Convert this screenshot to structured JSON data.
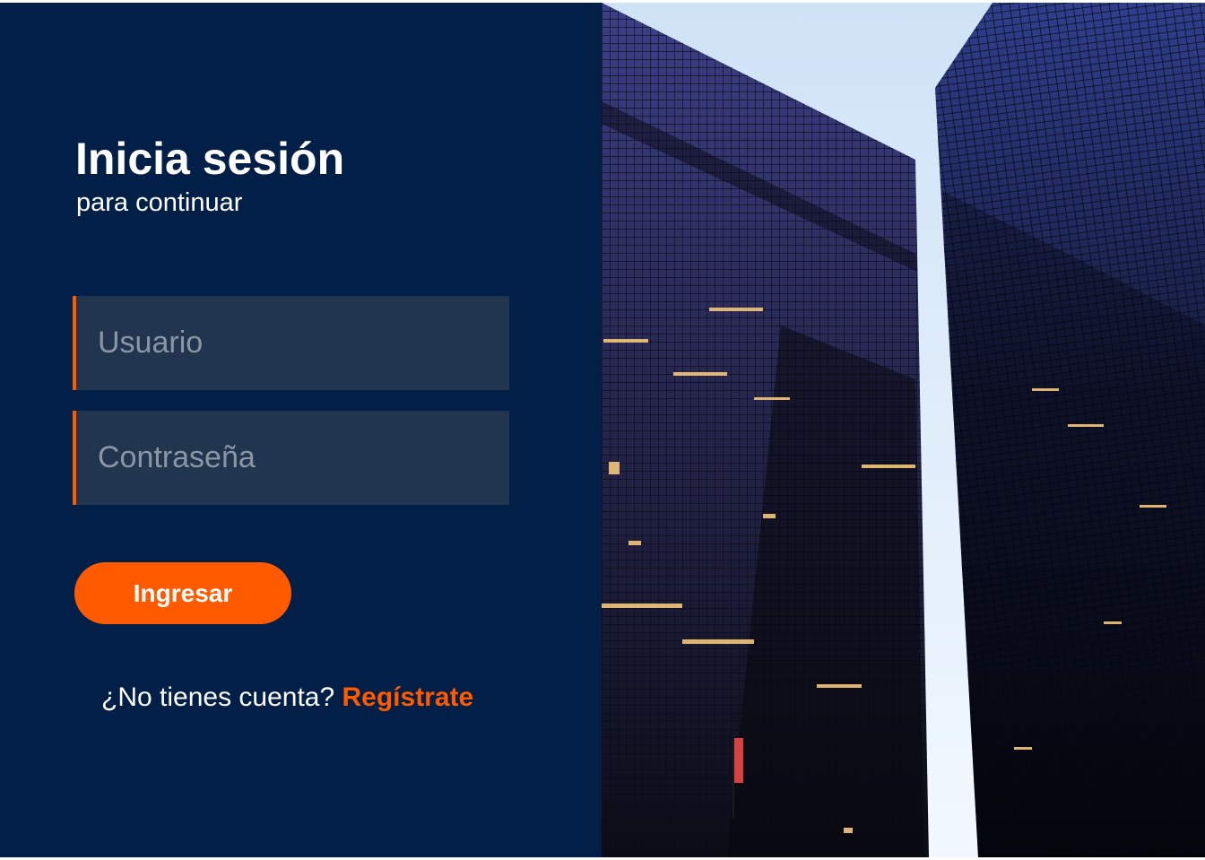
{
  "login": {
    "title": "Inicia sesión",
    "subtitle": "para continuar",
    "username_placeholder": "Usuario",
    "password_placeholder": "Contraseña",
    "submit_label": "Ingresar",
    "signup_prompt": "¿No tienes cuenta?",
    "signup_link": "Regístrate"
  },
  "colors": {
    "panel_background": "#011f47",
    "field_background": "#22354f",
    "accent": "#ff5a00",
    "text": "#ffffff",
    "placeholder": "#8b96a5"
  },
  "hero_image": {
    "icon": "city-skyscrapers-photo"
  }
}
